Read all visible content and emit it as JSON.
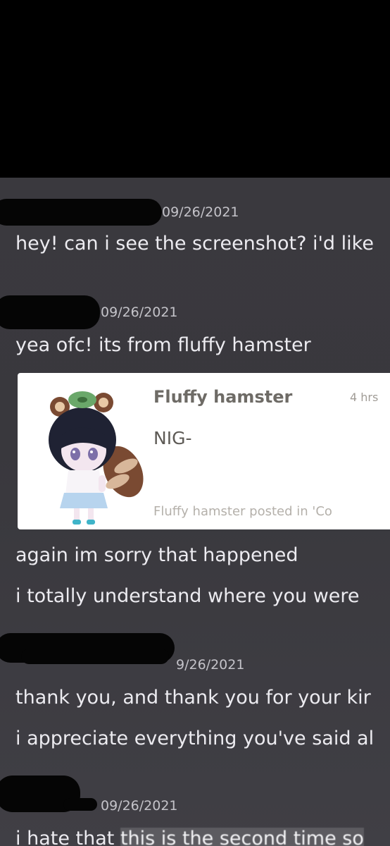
{
  "messages": [
    {
      "timestamp": "09/26/2021",
      "lines": [
        "hey! can i see the screenshot? i'd like"
      ]
    },
    {
      "timestamp": "09/26/2021",
      "lines": [
        "yea ofc! its from fluffy hamster"
      ]
    },
    {
      "lines": [
        "again im sorry that happened",
        "i totally understand where you were"
      ]
    },
    {
      "timestamp": "9/26/2021",
      "lines": [
        "thank you, and thank you for your kir",
        "i appreciate everything you've said al"
      ]
    },
    {
      "timestamp": "09/26/2021",
      "lines": [
        "i hate that",
        "this is the second time so"
      ]
    }
  ],
  "embed": {
    "author": "Fluffy hamster",
    "time": "4 hrs",
    "body": "NIG-",
    "footer": "Fluffy hamster posted in 'Co"
  },
  "colors": {
    "background": "#3a393e",
    "text": "#ecebf0",
    "timestamp": "#c4c3c9",
    "redaction": "#050505"
  },
  "icons": {
    "embed_avatar": "chibi-character-avatar"
  }
}
